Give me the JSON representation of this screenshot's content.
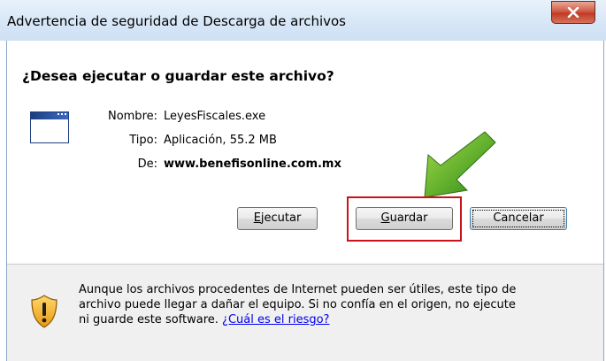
{
  "window": {
    "title": "Advertencia de seguridad de Descarga de archivos",
    "close_icon": "close-icon"
  },
  "dialog": {
    "question": "¿Desea ejecutar o guardar este archivo?",
    "file_icon": "application-window-icon",
    "fields": {
      "name_label": "Nombre:",
      "name_value": "LeyesFiscales.exe",
      "type_label": "Tipo:",
      "type_value": "Aplicación, 55.2 MB",
      "from_label": "De:",
      "from_value": "www.benefisonline.com.mx"
    },
    "buttons": {
      "run_prefix": "",
      "run_accel": "E",
      "run_rest": "jecutar",
      "save_accel": "G",
      "save_rest": "uardar",
      "cancel": "Cancelar"
    },
    "highlight_color": "#c9121b",
    "arrow_icon": "green-arrow-icon"
  },
  "footer": {
    "shield_icon": "shield-warning-icon",
    "warning_text": "Aunque los archivos procedentes de Internet pueden ser útiles, este tipo de archivo puede llegar a dañar el equipo. Si no confía en el origen, no ejecute ni guarde este software.",
    "link_text": "¿Cuál es el riesgo?"
  }
}
